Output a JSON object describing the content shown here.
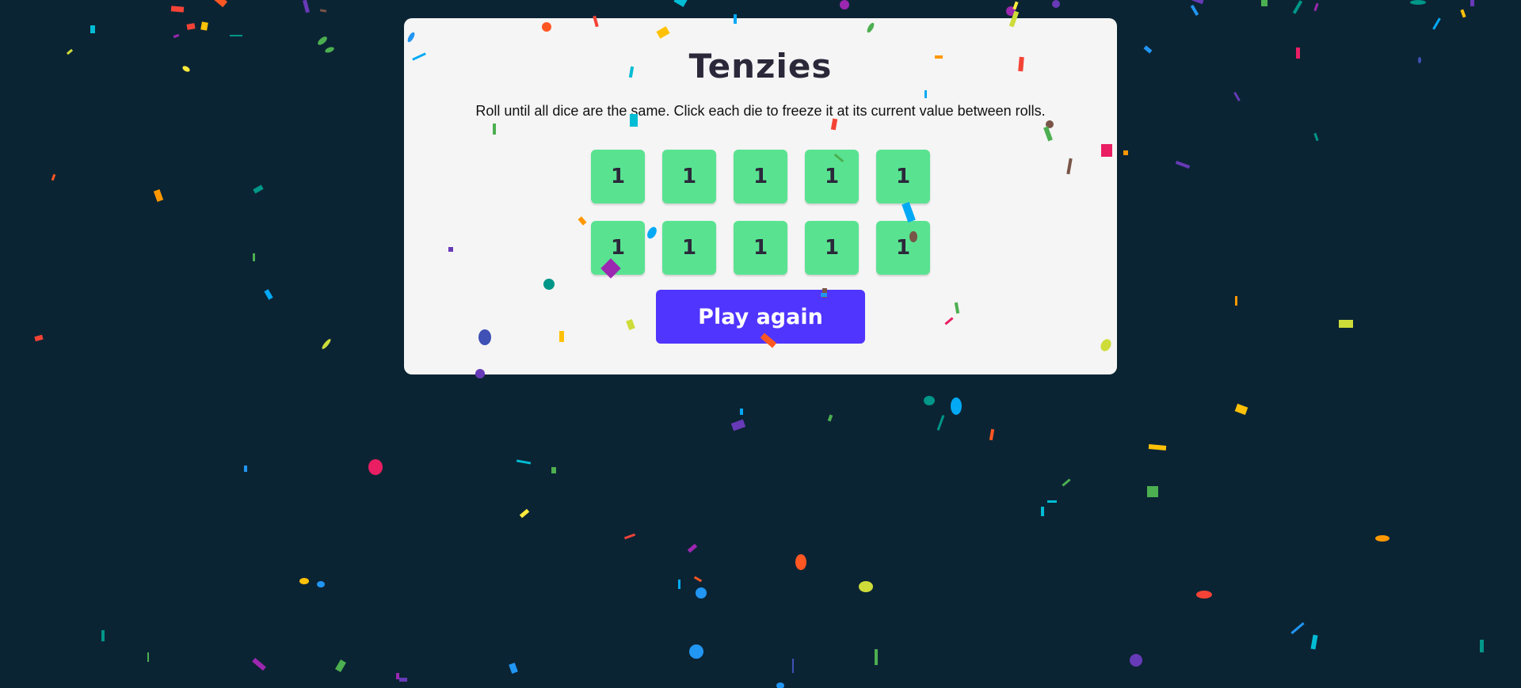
{
  "app": {
    "title": "Tenzies",
    "instructions": "Roll until all dice are the same. Click each die to freeze it at its current value between rolls."
  },
  "dice": [
    "1",
    "1",
    "1",
    "1",
    "1",
    "1",
    "1",
    "1",
    "1",
    "1"
  ],
  "actions": {
    "play_again_label": "Play again"
  },
  "colors": {
    "background": "#0b2434",
    "card": "#f5f5f5",
    "die_held": "#59e391",
    "button": "#5035ff",
    "confetti": [
      "#f44336",
      "#e91e63",
      "#9c27b0",
      "#673ab7",
      "#3f51b5",
      "#2196f3",
      "#03a9f4",
      "#00bcd4",
      "#009688",
      "#4caf50",
      "#8bc34a",
      "#cddc39",
      "#ffeb3b",
      "#ffc107",
      "#ff9800",
      "#ff5722",
      "#795548"
    ]
  }
}
